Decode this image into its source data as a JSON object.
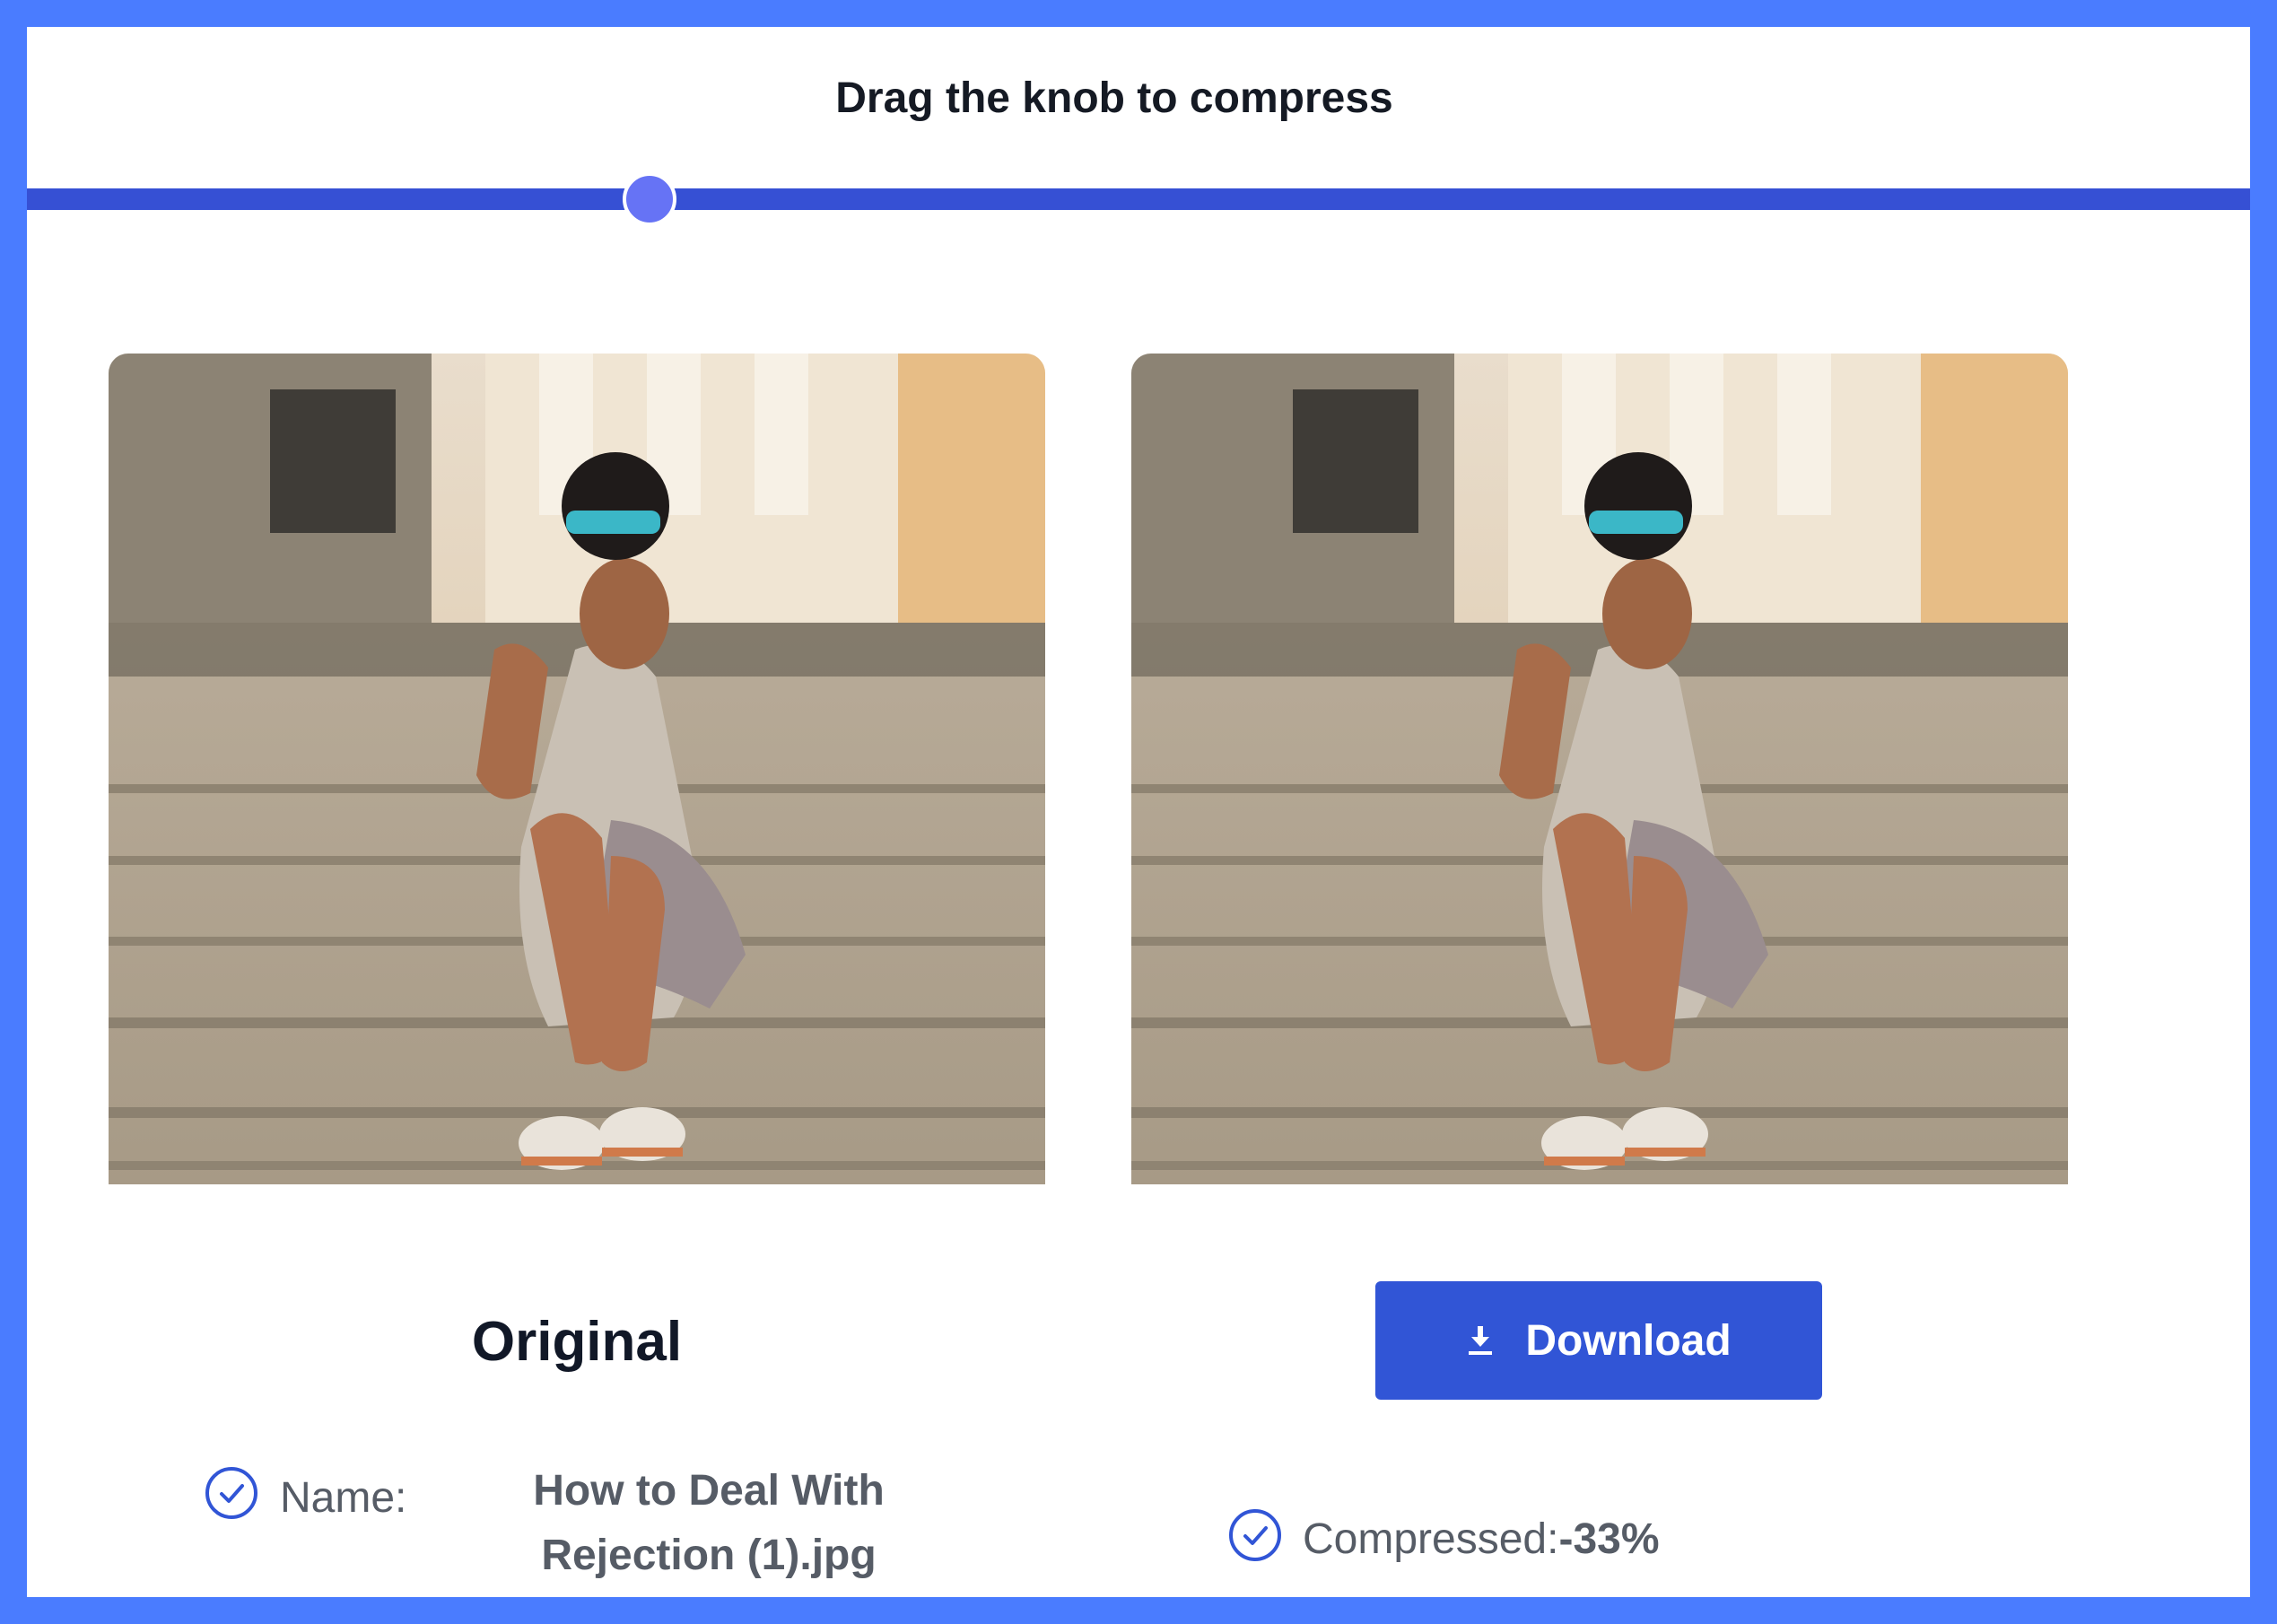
{
  "heading": "Drag the knob to compress",
  "slider": {
    "value_fraction": 0.28
  },
  "original_label": "Original",
  "download_button": {
    "label": "Download",
    "icon": "download-icon"
  },
  "file_info": {
    "name_label": "Name:",
    "name_line1": "How to Deal With",
    "name_line2": "Rejection (1).jpg",
    "compressed_label": "Compressed:",
    "compressed_value": "-33%"
  },
  "colors": {
    "frame": "#4a7cff",
    "track": "#3650d4",
    "knob": "#6673f5",
    "button": "#3155d6"
  }
}
